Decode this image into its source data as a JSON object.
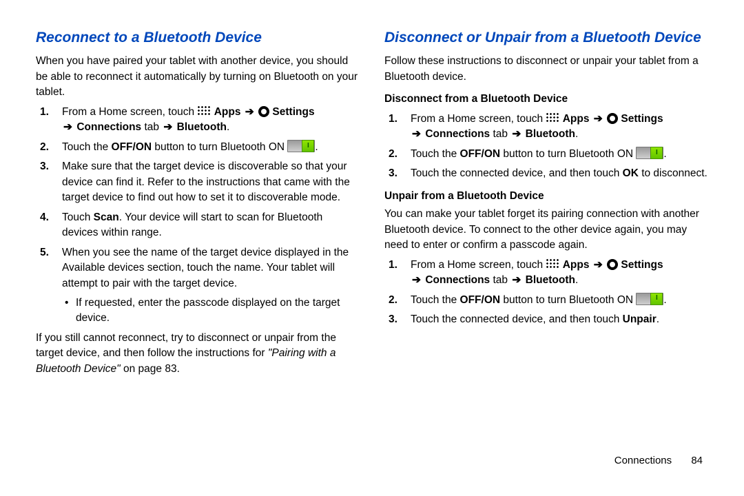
{
  "left": {
    "heading": "Reconnect to a Bluetooth Device",
    "intro": "When you have paired your tablet with another device, you should be able to reconnect it automatically by turning on Bluetooth on your tablet.",
    "steps": {
      "s1_pre": "From a Home screen, touch ",
      "apps": "Apps",
      "settings": "Settings",
      "conn_tab": "Connections",
      "tab_word": " tab ",
      "bt": "Bluetooth",
      "period": ".",
      "s2_a": "Touch the ",
      "s2_b": "OFF/ON",
      "s2_c": " button to turn Bluetooth ON ",
      "s3": "Make sure that the target device is discoverable so that your device can find it. Refer to the instructions that came with the target device to find out how to set it to discoverable mode.",
      "s4_a": "Touch ",
      "s4_b": "Scan",
      "s4_c": ". Your device will start to scan for Bluetooth devices within range.",
      "s5": "When you see the name of the target device displayed in the Available devices section, touch the name. Your tablet will attempt to pair with the target device.",
      "bullet": "If requested, enter the passcode displayed on the target device."
    },
    "outro_a": "If you still cannot reconnect, try to disconnect or unpair from the target device, and then follow the instructions for ",
    "outro_ref": "\"Pairing with a Bluetooth Device\"",
    "outro_b": " on page 83."
  },
  "right": {
    "heading": "Disconnect or Unpair from a Bluetooth Device",
    "intro": "Follow these instructions to disconnect or unpair your tablet from a Bluetooth device.",
    "sub1": "Disconnect from a Bluetooth Device",
    "d_s1_pre": "From a Home screen, touch ",
    "apps": "Apps",
    "settings": "Settings",
    "conn_tab": "Connections",
    "tab_word": " tab ",
    "bt": "Bluetooth",
    "period": ".",
    "d_s2_a": "Touch the ",
    "d_s2_b": "OFF/ON",
    "d_s2_c": " button to turn Bluetooth ON ",
    "d_s3_a": "Touch the connected device, and then touch ",
    "d_s3_b": "OK",
    "d_s3_c": " to disconnect.",
    "sub2": "Unpair from a Bluetooth Device",
    "u_intro": "You can make your tablet forget its pairing connection with another Bluetooth device. To connect to the other device again, you may need to enter or confirm a passcode again.",
    "u_s1_pre": "From a Home screen, touch ",
    "u_s2_a": "Touch the ",
    "u_s2_b": "OFF/ON",
    "u_s2_c": " button to turn Bluetooth ON ",
    "u_s3_a": "Touch the connected device, and then touch ",
    "u_s3_b": "Unpair",
    "u_s3_c": "."
  },
  "arrow": "➔",
  "footer": {
    "section": "Connections",
    "page": "84"
  }
}
